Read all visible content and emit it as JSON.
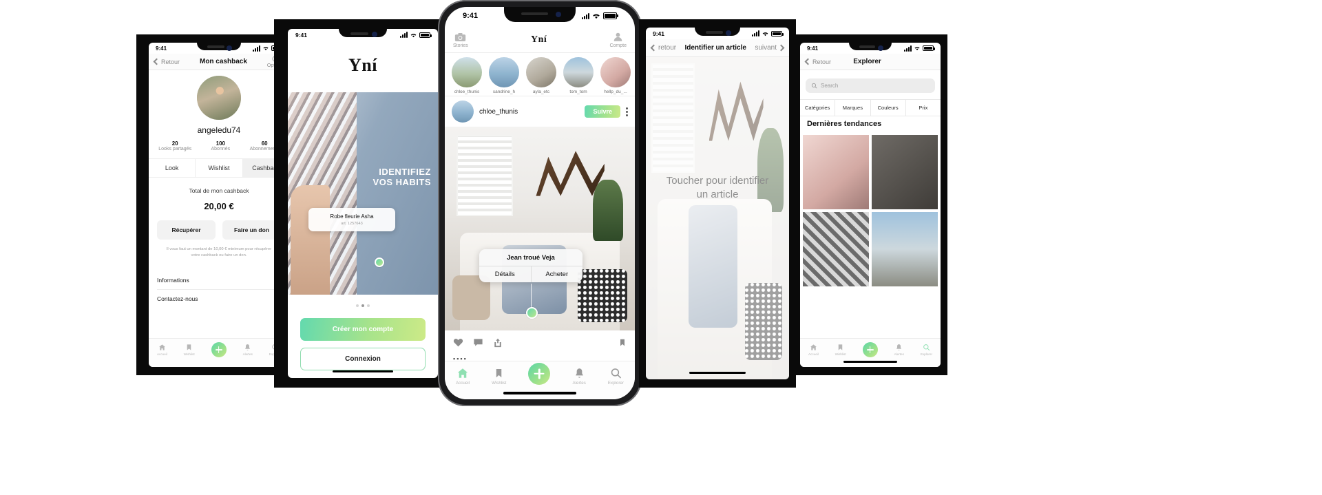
{
  "common": {
    "status_time": "9:41"
  },
  "phone1": {
    "nav": {
      "back": "Retour",
      "title": "Mon cashback",
      "right_label": "Options"
    },
    "profile": {
      "username": "angeledu74",
      "stats": [
        {
          "num": "20",
          "label": "Looks partagés"
        },
        {
          "num": "100",
          "label": "Abonnés"
        },
        {
          "num": "60",
          "label": "Abonnements"
        }
      ]
    },
    "tabs": [
      {
        "label": "Look",
        "active": false
      },
      {
        "label": "Wishlist",
        "active": false
      },
      {
        "label": "Cashback",
        "active": true
      }
    ],
    "cashback": {
      "total_label": "Total de mon cashback",
      "amount": "20,00  €",
      "buttons": [
        "Récupérer",
        "Faire un don"
      ],
      "note_line1": "Il vous faut un montant de 10,00 € minimum pour récupérer",
      "note_line2": "votre cashback ou faire un don."
    },
    "sections": [
      "Informations",
      "Contactez-nous"
    ],
    "tabbar": [
      "Accueil",
      "Wishlist",
      "Alertes",
      "Explorer"
    ]
  },
  "phone2": {
    "brand": "Yní",
    "hero": {
      "line1": "IDENTIFIEZ",
      "line2": "VOS HABITS"
    },
    "tag": {
      "title": "Robe fleurie Asha",
      "sub": "art. 1257643"
    },
    "pager": {
      "count": 3,
      "active": 1
    },
    "cta": {
      "primary": "Créer mon compte",
      "secondary": "Connexion"
    }
  },
  "phone3": {
    "header": {
      "left_label": "Stories",
      "title": "Yní",
      "right_label": "Compte"
    },
    "stories": [
      {
        "name": "chloe_thunis"
      },
      {
        "name": "sandrine_h"
      },
      {
        "name": "ayla_etc"
      },
      {
        "name": "tom_tom"
      },
      {
        "name": "hellp_du_..."
      }
    ],
    "post": {
      "author": "chloe_thunis",
      "follow_label": "Suivre"
    },
    "popup": {
      "title": "Jean troué Veja",
      "left_action": "Détails",
      "right_action": "Acheter"
    },
    "tabbar": [
      {
        "label": "Accueil",
        "icon": "home-icon",
        "active": true
      },
      {
        "label": "Wishlist",
        "icon": "bookmark-icon",
        "active": false
      },
      {
        "label": "Alertes",
        "icon": "bell-icon",
        "active": false
      },
      {
        "label": "Explorer",
        "icon": "search-icon",
        "active": false
      }
    ],
    "fab": "+"
  },
  "phone4": {
    "nav": {
      "back": "retour",
      "title": "Identifier un article",
      "next": "suivant"
    },
    "overlay": {
      "line1": "Toucher pour identifier",
      "line2": "un article"
    }
  },
  "phone5": {
    "nav": {
      "back": "Retour",
      "title": "Explorer"
    },
    "search": {
      "placeholder": "Search"
    },
    "filters": [
      "Catégories",
      "Marques",
      "Couleurs",
      "Prix"
    ],
    "section_title": "Dernières tendances",
    "tabbar": [
      "Accueil",
      "Wishlist",
      "Alertes",
      "Explorer"
    ]
  },
  "colors": {
    "accent_green_start": "#63d9ae",
    "accent_green_end": "#cbe98a",
    "muted_text": "#8d8d8d",
    "body_text": "#1a1a1a"
  }
}
